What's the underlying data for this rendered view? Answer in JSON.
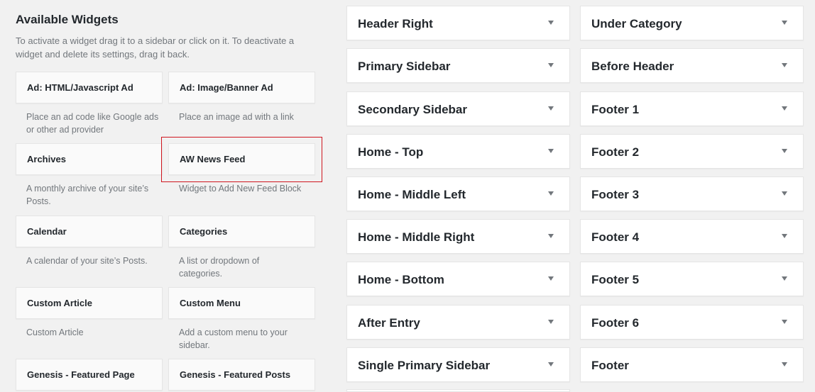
{
  "available": {
    "title": "Available Widgets",
    "description": "To activate a widget drag it to a sidebar or click on it. To deactivate a widget and delete its settings, drag it back."
  },
  "widgets": [
    {
      "title": "Ad: HTML/Javascript Ad",
      "desc": "Place an ad code like Google ads or other ad provider"
    },
    {
      "title": "Ad: Image/Banner Ad",
      "desc": "Place an image ad with a link"
    },
    {
      "title": "Archives",
      "desc": "A monthly archive of your site’s Posts."
    },
    {
      "title": "AW News Feed",
      "desc": "Widget to Add New Feed Block"
    },
    {
      "title": "Calendar",
      "desc": "A calendar of your site’s Posts."
    },
    {
      "title": "Categories",
      "desc": "A list or dropdown of categories."
    },
    {
      "title": "Custom Article",
      "desc": "Custom Article"
    },
    {
      "title": "Custom Menu",
      "desc": "Add a custom menu to your sidebar."
    },
    {
      "title": "Genesis - Featured Page",
      "desc": ""
    },
    {
      "title": "Genesis - Featured Posts",
      "desc": ""
    }
  ],
  "sidebars_col1": [
    {
      "title": "Header Right"
    },
    {
      "title": "Primary Sidebar"
    },
    {
      "title": "Secondary Sidebar"
    },
    {
      "title": "Home - Top"
    },
    {
      "title": "Home - Middle Left"
    },
    {
      "title": "Home - Middle Right"
    },
    {
      "title": "Home - Bottom"
    },
    {
      "title": "After Entry"
    },
    {
      "title": "Single Primary Sidebar"
    }
  ],
  "sidebars_col2": [
    {
      "title": "Under Category"
    },
    {
      "title": "Before Header"
    },
    {
      "title": "Footer 1"
    },
    {
      "title": "Footer 2"
    },
    {
      "title": "Footer 3"
    },
    {
      "title": "Footer 4"
    },
    {
      "title": "Footer 5"
    },
    {
      "title": "Footer 6"
    },
    {
      "title": "Footer"
    }
  ]
}
